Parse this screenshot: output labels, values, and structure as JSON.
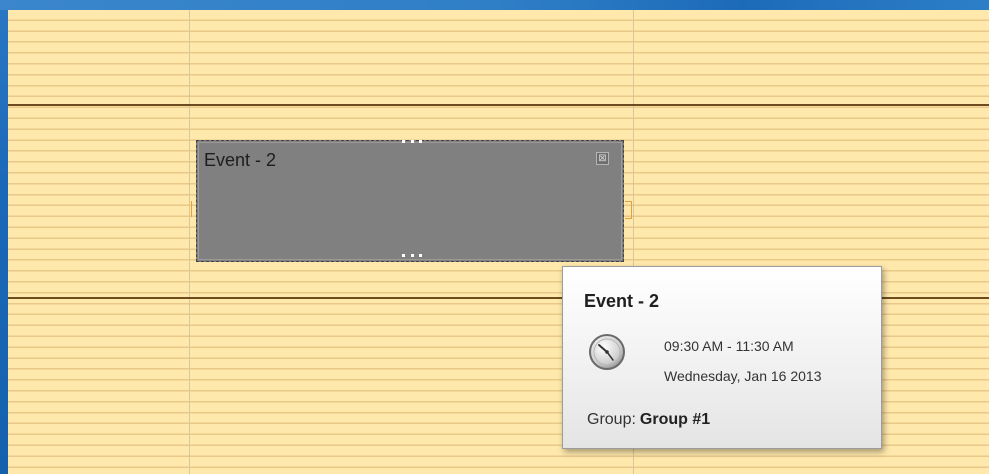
{
  "event": {
    "title": "Event - 2",
    "close_glyph": "⊠"
  },
  "tooltip": {
    "title": "Event - 2",
    "time_range": "09:30 AM - 11:30 AM",
    "date": "Wednesday, Jan 16 2013",
    "group_label": "Group:",
    "group_value": "Group #1",
    "icon": "clock-icon"
  },
  "colors": {
    "frame_blue": "#1a68b8",
    "slot_background": "#ffe8ab",
    "slot_line": "#e8c98a",
    "hour_line": "#6d4b1f",
    "event_fill": "#808080",
    "selection_marker": "#e6a23a"
  }
}
